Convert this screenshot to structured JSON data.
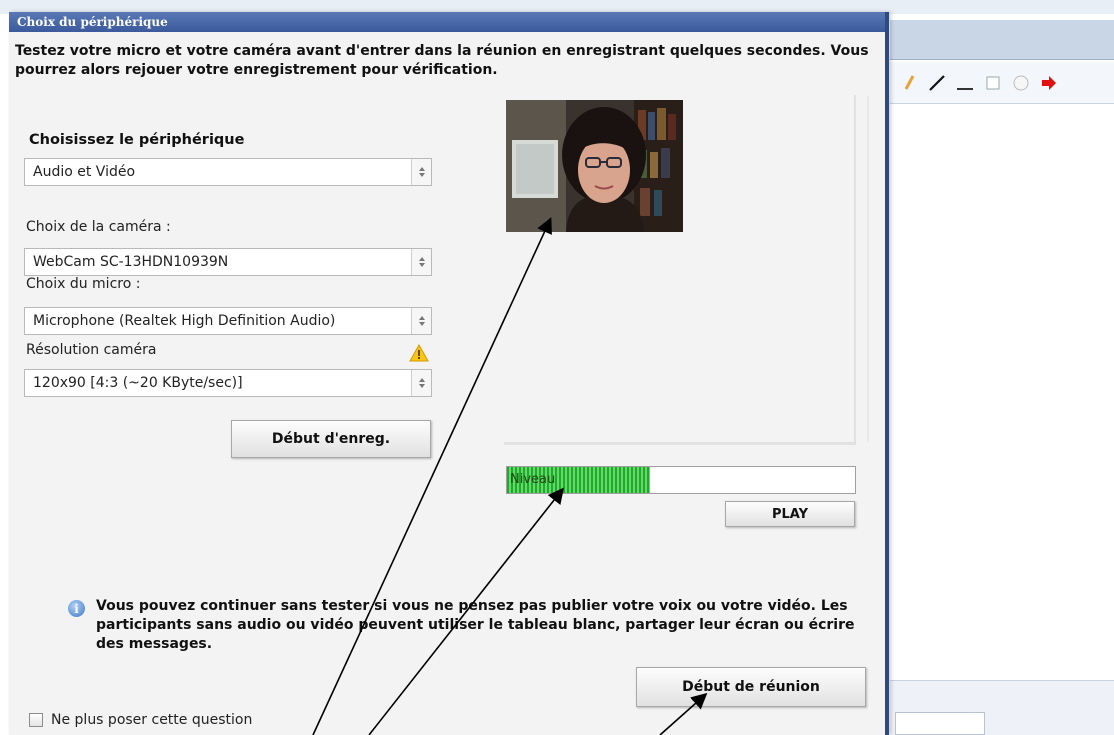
{
  "dialog": {
    "title": "Choix du périphérique",
    "intro": "Testez votre micro et votre caméra avant d'entrer dans la réunion en enregistrant quelques secondes. Vous pourrez alors rejouer votre enregistrement pour vérification.",
    "device_section_title": "Choisissez le périphérique",
    "device_select_value": "Audio et Vidéo",
    "camera_label": "Choix de la caméra :",
    "camera_select_value": "WebCam SC-13HDN10939N",
    "mic_label": "Choix du micro :",
    "mic_select_value": "Microphone (Realtek High Definition Audio)",
    "resolution_label": "Résolution caméra",
    "resolution_select_value": "120x90 [4:3 (~20 KByte/sec)]",
    "record_button": "Début d'enreg.",
    "level_label": "Niveau",
    "level_value": 0.41,
    "play_button": "PLAY",
    "info_text": "Vous pouvez continuer sans tester si vous ne pensez pas publier votre voix ou votre vidéo. Les participants sans audio ou vidéo peuvent utiliser le tableau blanc, partager leur écran ou écrire des messages.",
    "start_meeting_button": "Début de réunion",
    "dont_ask_label": "Ne plus poser cette question",
    "dont_ask_checked": false
  },
  "toolbar_icons": [
    "pencil-icon",
    "line-icon",
    "underline-icon",
    "rectangle-icon",
    "ellipse-icon",
    "arrow-icon"
  ],
  "colors": {
    "titlebar": "#3b5a9c",
    "level_green": "#2fbf3a",
    "arrow_red": "#e01010"
  }
}
